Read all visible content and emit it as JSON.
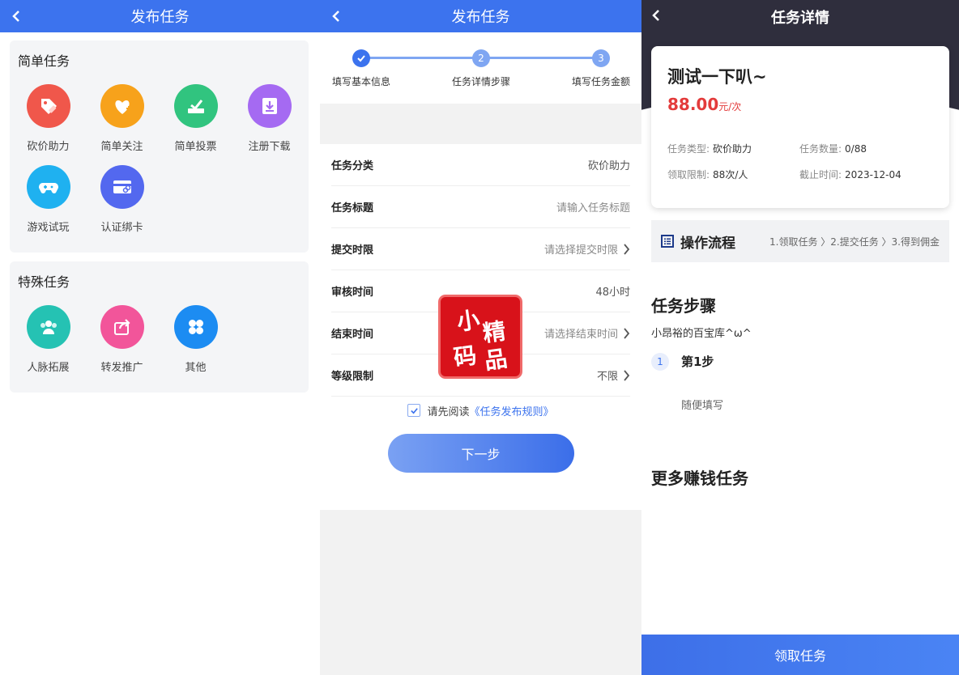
{
  "colors": {
    "primary": "#3c73ee",
    "price_red": "#e33b3b",
    "dark_header": "#2f2e3d"
  },
  "publish": {
    "title": "发布任务",
    "simple_section": "简单任务",
    "simple_items": [
      {
        "label": "砍价助力",
        "icon": "tag-icon",
        "color": "#f0574b"
      },
      {
        "label": "简单关注",
        "icon": "heart-plus-icon",
        "color": "#f7a21b"
      },
      {
        "label": "简单投票",
        "icon": "vote-icon",
        "color": "#31c47f"
      },
      {
        "label": "注册下载",
        "icon": "download-icon",
        "color": "#a56af2"
      },
      {
        "label": "游戏试玩",
        "icon": "gamepad-icon",
        "color": "#1fb1f0"
      },
      {
        "label": "认证绑卡",
        "icon": "card-link-icon",
        "color": "#5368ef"
      }
    ],
    "special_section": "特殊任务",
    "special_items": [
      {
        "label": "人脉拓展",
        "icon": "people-icon",
        "color": "#25c2b3"
      },
      {
        "label": "转发推广",
        "icon": "share-icon",
        "color": "#f2559a"
      },
      {
        "label": "其他",
        "icon": "clover-icon",
        "color": "#1c8cf2"
      }
    ]
  },
  "form": {
    "title": "发布任务",
    "steps": [
      {
        "num": "1",
        "label": "填写基本信息",
        "done": true
      },
      {
        "num": "2",
        "label": "任务详情步骤",
        "done": false
      },
      {
        "num": "3",
        "label": "填写任务金额",
        "done": false
      }
    ],
    "rows": [
      {
        "label": "任务分类",
        "value": "砍价助力",
        "placeholder": false,
        "arrow": false
      },
      {
        "label": "任务标题",
        "value": "请输入任务标题",
        "placeholder": true,
        "arrow": false
      },
      {
        "label": "提交时限",
        "value": "请选择提交时限",
        "placeholder": true,
        "arrow": true
      },
      {
        "label": "审核时间",
        "value": "48小时",
        "placeholder": false,
        "arrow": false
      },
      {
        "label": "结束时间",
        "value": "请选择结束时间",
        "placeholder": true,
        "arrow": true
      },
      {
        "label": "等级限制",
        "value": "不限",
        "placeholder": false,
        "arrow": true
      }
    ],
    "agree_prefix": "请先阅读",
    "agree_link": "《任务发布规则》",
    "next_label": "下一步",
    "stamp": [
      "小",
      "精",
      "码",
      "品"
    ]
  },
  "detail": {
    "title": "任务详情",
    "task_name": "测试一下叭~",
    "price": "88.00",
    "price_unit": "元/次",
    "type_label": "任务类型:",
    "type_value": "砍价助力",
    "count_label": "任务数量:",
    "count_value": "0/88",
    "limit_label": "领取限制:",
    "limit_value": "88次/人",
    "deadline_label": "截止时间:",
    "deadline_value": "2023-12-04",
    "flow_title": "操作流程",
    "flow_steps": "1.领取任务 〉2.提交任务 〉3.得到佣金",
    "steps_title": "任务步骤",
    "steps_desc": "小昂裕的百宝库^ω^",
    "step1_num": "1",
    "step1_name": "第1步",
    "step1_desc": "随便填写",
    "more_title": "更多赚钱任务",
    "take_label": "领取任务"
  }
}
